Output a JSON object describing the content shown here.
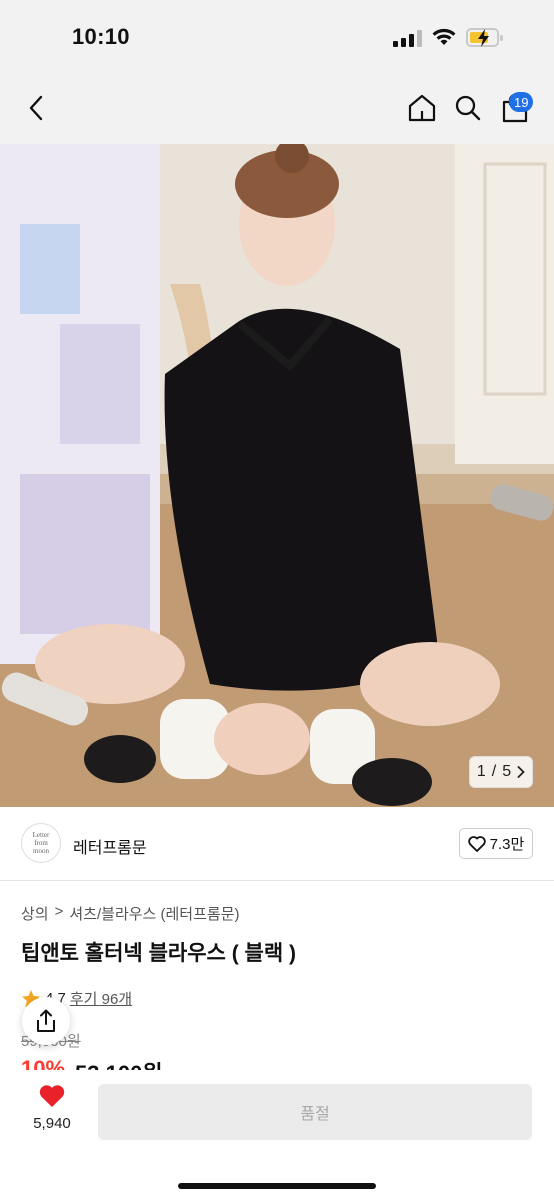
{
  "status_bar": {
    "time": "10:10"
  },
  "nav": {
    "cart_count": "19"
  },
  "gallery": {
    "current": "1",
    "separator": "/",
    "total": "5"
  },
  "brand": {
    "name": "레터프롬문",
    "logo_text": "Letter from moon",
    "like_count": "7.3만"
  },
  "breadcrumb": {
    "items": [
      "상의",
      "셔츠/블라우스 (레터프롬문)"
    ],
    "separator": ">"
  },
  "product": {
    "title": "팁앤토 홀터넥 블라우스 ( 블랙 )",
    "rating": "4.7",
    "review_label": "후기 96개",
    "original_price": "59,000원",
    "discount": "10%",
    "price": "53,100원"
  },
  "bottom_bar": {
    "heart_count": "5,940",
    "soldout_label": "품절"
  },
  "colors": {
    "accent": "#1f6fe6",
    "sale": "#ff3b30",
    "heart": "#e8212b"
  }
}
